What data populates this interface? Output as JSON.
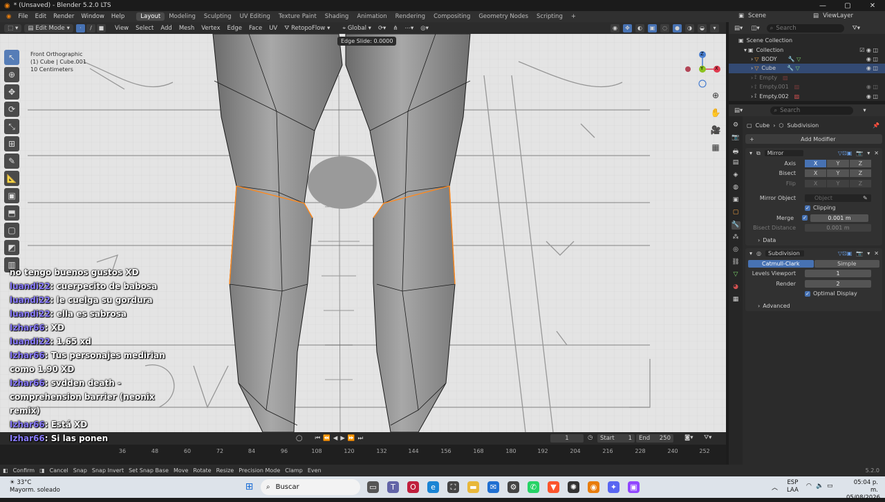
{
  "titlebar": {
    "title": "* (Unsaved) - Blender 5.2.0 LTS"
  },
  "menu": {
    "items": [
      "File",
      "Edit",
      "Render",
      "Window",
      "Help"
    ],
    "workspaces": [
      "Layout",
      "Modeling",
      "Sculpting",
      "UV Editing",
      "Texture Paint",
      "Shading",
      "Animation",
      "Rendering",
      "Compositing",
      "Geometry Nodes",
      "Scripting"
    ],
    "active_workspace": "Layout",
    "add_tab": "+"
  },
  "scene": {
    "label": "Scene",
    "viewlayer": "ViewLayer"
  },
  "viewport_header": {
    "mode": "Edit Mode",
    "menus": [
      "View",
      "Select",
      "Add",
      "Mesh",
      "Vertex",
      "Edge",
      "Face",
      "UV"
    ],
    "addon": "RetopoFlow",
    "orientation": "Global"
  },
  "viewport": {
    "view_name": "Front Orthographic",
    "object_line": "(1) Cube | Cube.001",
    "scale": "10 Centimeters",
    "operator": "Edge Slide: 0.0000",
    "gizmo": {
      "x": "X",
      "y": "Y",
      "z": "Z"
    }
  },
  "chat": [
    {
      "user": "",
      "text": "no tengo buenos gustos XD"
    },
    {
      "user": "luandi22",
      "text": ": cuerpecito de babosa"
    },
    {
      "user": "luandi22",
      "text": ": le cuelga su gordura"
    },
    {
      "user": "luandi22",
      "text": ": ella es sabrosa"
    },
    {
      "user": "Izhar66",
      "text": ": XD"
    },
    {
      "user": "luandi22",
      "text": ": 1.65 xd"
    },
    {
      "user": "Izhar66",
      "text": ": Tus personajes medirian como 1.90 XD"
    },
    {
      "user": "Izhar66",
      "text": ": svdden death - comprehension barrier (neonix remix)"
    },
    {
      "user": "Izhar66",
      "text": ": Está XD"
    },
    {
      "user": "Izhar66",
      "text": ": Si las ponen"
    }
  ],
  "timeline": {
    "current_frame": "1",
    "start_label": "Start",
    "start": "1",
    "end_label": "End",
    "end": "250",
    "ticks": [
      "36",
      "48",
      "60",
      "72",
      "84",
      "96",
      "108",
      "120",
      "132",
      "144",
      "156",
      "168",
      "180",
      "192",
      "204",
      "216",
      "228",
      "240",
      "252"
    ]
  },
  "outliner": {
    "search_placeholder": "Search",
    "items": [
      {
        "label": "Scene Collection",
        "indent": 0,
        "selected": false,
        "dim": false
      },
      {
        "label": "Collection",
        "indent": 1,
        "selected": false,
        "dim": false
      },
      {
        "label": "BODY",
        "indent": 2,
        "selected": false,
        "dim": false
      },
      {
        "label": "Cube",
        "indent": 2,
        "selected": true,
        "dim": false
      },
      {
        "label": "Empty",
        "indent": 2,
        "selected": false,
        "dim": true
      },
      {
        "label": "Empty.001",
        "indent": 2,
        "selected": false,
        "dim": true
      },
      {
        "label": "Empty.002",
        "indent": 2,
        "selected": false,
        "dim": false
      }
    ]
  },
  "properties": {
    "search_placeholder": "Search",
    "breadcrumb_object": "Cube",
    "breadcrumb_modifier": "Subdivision",
    "add_modifier": "Add Modifier",
    "mirror": {
      "name": "Mirror",
      "axis_label": "Axis",
      "bisect_label": "Bisect",
      "flip_label": "Flip",
      "x": "X",
      "y": "Y",
      "z": "Z",
      "mirror_object_label": "Mirror Object",
      "mirror_object_placeholder": "Object",
      "clipping": "Clipping",
      "merge_label": "Merge",
      "merge_value": "0.001 m",
      "bisect_distance_label": "Bisect Distance",
      "bisect_distance_value": "0.001 m",
      "data_label": "Data"
    },
    "subdivision": {
      "name": "Subdivision",
      "tab_cc": "Catmull-Clark",
      "tab_simple": "Simple",
      "levels_label": "Levels Viewport",
      "levels_value": "1",
      "render_label": "Render",
      "render_value": "2",
      "optimal_display": "Optimal Display",
      "advanced": "Advanced"
    }
  },
  "statusbar": {
    "keys": [
      "Confirm",
      "Cancel",
      "Snap",
      "Snap Invert",
      "Set Snap Base",
      "Move",
      "Rotate",
      "Resize",
      "Precision Mode",
      "Clamp",
      "Even"
    ],
    "version": "5.2.0"
  },
  "taskbar": {
    "temp": "33°C",
    "weather": "Mayorm. soleado",
    "search": "Buscar",
    "lang1": "ESP",
    "lang2": "LAA",
    "time": "05:04 p. m.",
    "date": "05/08/2026"
  },
  "colors": {
    "accent": "#4772b3",
    "selection": "#ff8a1e",
    "menubar": "#303030"
  }
}
